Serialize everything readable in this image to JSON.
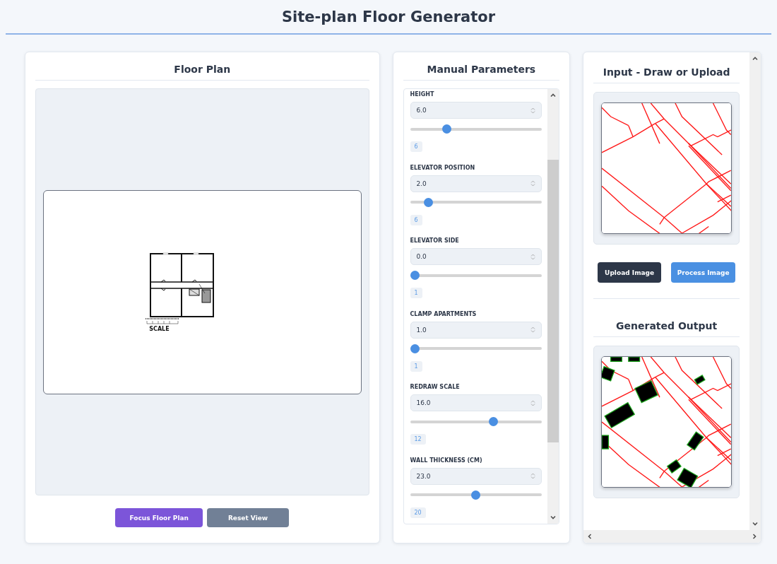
{
  "header": {
    "title": "Site-plan Floor Generator"
  },
  "floor_plan": {
    "title": "Floor Plan",
    "scale_label": "SCALE",
    "buttons": [
      {
        "label": "Focus Floor Plan",
        "kind": "primary"
      },
      {
        "label": "Reset View",
        "kind": "secondary"
      }
    ]
  },
  "parameters": {
    "title": "Manual Parameters",
    "items": [
      {
        "label": "HEIGHT",
        "value": "6.0",
        "level": 0.26,
        "badge": "6"
      },
      {
        "label": "ELEVATOR POSITION",
        "value": "2.0",
        "level": 0.11,
        "badge": "6"
      },
      {
        "label": "ELEVATOR SIDE",
        "value": "0.0",
        "level": 0,
        "badge": "1"
      },
      {
        "label": "CLAMP APARTMENTS",
        "value": "1.0",
        "level": 0,
        "badge": "1"
      },
      {
        "label": "REDRAW SCALE",
        "value": "16.0",
        "level": 0.64,
        "badge": "12"
      },
      {
        "label": "WALL THICKNESS (CM)",
        "value": "23.0",
        "level": 0.5,
        "badge": "20"
      }
    ]
  },
  "input": {
    "title": "Input - Draw or Upload",
    "buttons": [
      {
        "label": "Upload Image",
        "kind": "dark"
      },
      {
        "label": "Process Image",
        "kind": "primary"
      }
    ]
  },
  "output": {
    "title": "Generated Output"
  }
}
